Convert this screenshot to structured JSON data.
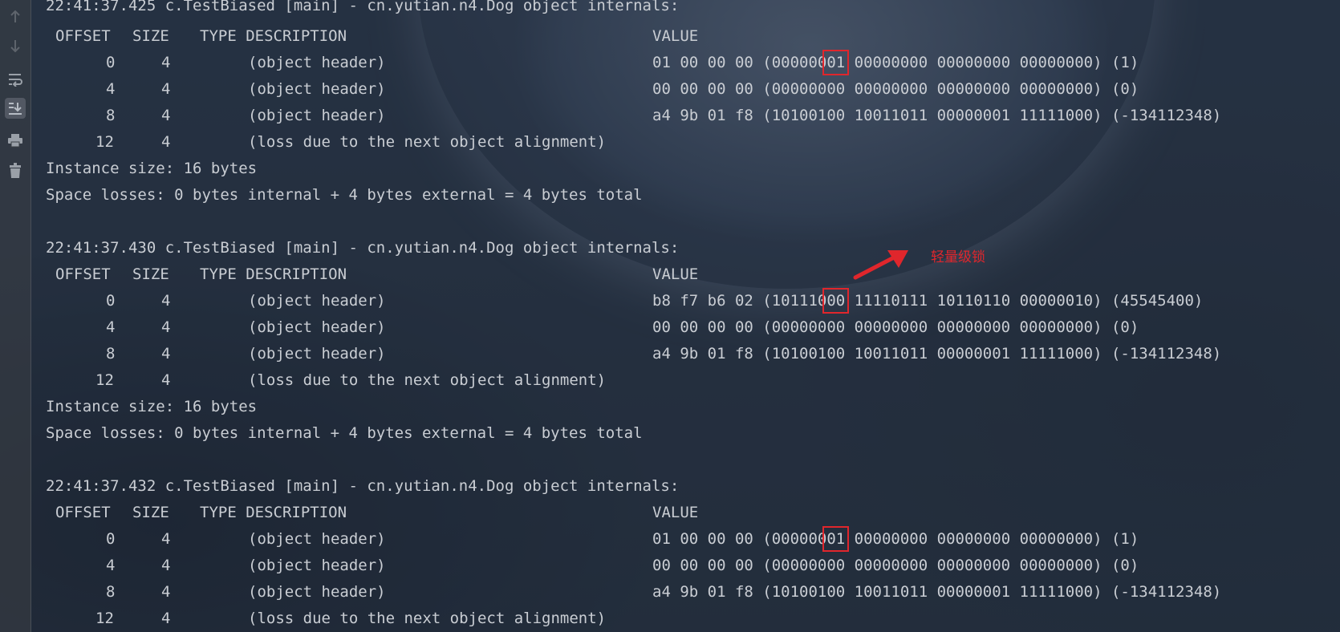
{
  "toolbar": {
    "items": [
      {
        "name": "up-arrow-icon",
        "glyph": "↑"
      },
      {
        "name": "down-arrow-icon",
        "glyph": "↓"
      },
      {
        "name": "soft-wrap-icon",
        "glyph": "⤶"
      },
      {
        "name": "scroll-to-end-icon",
        "glyph": "⤓"
      },
      {
        "name": "print-icon",
        "glyph": "🖶"
      },
      {
        "name": "trash-icon",
        "glyph": "🗑"
      }
    ]
  },
  "annotation": {
    "label": "轻量级锁",
    "color": "#e0262c"
  },
  "blocks": [
    {
      "title": "22:41:37.425 c.TestBiased [main] - cn.yutian.n4.Dog object internals:",
      "header": {
        "offset": "OFFSET",
        "size": "SIZE",
        "type_desc": "TYPE DESCRIPTION",
        "value": "VALUE"
      },
      "rows": [
        {
          "offset": "0",
          "size": "4",
          "desc": "(object header)",
          "value_pre": "01 00 00 00 (000000",
          "value_hl": "01",
          "value_post": " 00000000 00000000 00000000) (1)"
        },
        {
          "offset": "4",
          "size": "4",
          "desc": "(object header)",
          "value_pre": "00 00 00 00 (00000000 00000000 00000000 00000000) (0)",
          "value_hl": "",
          "value_post": ""
        },
        {
          "offset": "8",
          "size": "4",
          "desc": "(object header)",
          "value_pre": "a4 9b 01 f8 (10100100 10011011 00000001 11111000) (-134112348)",
          "value_hl": "",
          "value_post": ""
        },
        {
          "offset": "12",
          "size": "4",
          "desc": "(loss due to the next object alignment)",
          "value_pre": "",
          "value_hl": "",
          "value_post": ""
        }
      ],
      "instance_size": "Instance size: 16 bytes",
      "space_losses": "Space losses: 0 bytes internal + 4 bytes external = 4 bytes total"
    },
    {
      "title": "22:41:37.430 c.TestBiased [main] - cn.yutian.n4.Dog object internals:",
      "header": {
        "offset": "OFFSET",
        "size": "SIZE",
        "type_desc": "TYPE DESCRIPTION",
        "value": "VALUE"
      },
      "rows": [
        {
          "offset": "0",
          "size": "4",
          "desc": "(object header)",
          "value_pre": "b8 f7 b6 02 (101110",
          "value_hl": "00",
          "value_post": " 11110111 10110110 00000010) (45545400)"
        },
        {
          "offset": "4",
          "size": "4",
          "desc": "(object header)",
          "value_pre": "00 00 00 00 (00000000 00000000 00000000 00000000) (0)",
          "value_hl": "",
          "value_post": ""
        },
        {
          "offset": "8",
          "size": "4",
          "desc": "(object header)",
          "value_pre": "a4 9b 01 f8 (10100100 10011011 00000001 11111000) (-134112348)",
          "value_hl": "",
          "value_post": ""
        },
        {
          "offset": "12",
          "size": "4",
          "desc": "(loss due to the next object alignment)",
          "value_pre": "",
          "value_hl": "",
          "value_post": ""
        }
      ],
      "instance_size": "Instance size: 16 bytes",
      "space_losses": "Space losses: 0 bytes internal + 4 bytes external = 4 bytes total"
    },
    {
      "title": "22:41:37.432 c.TestBiased [main] - cn.yutian.n4.Dog object internals:",
      "header": {
        "offset": "OFFSET",
        "size": "SIZE",
        "type_desc": "TYPE DESCRIPTION",
        "value": "VALUE"
      },
      "rows": [
        {
          "offset": "0",
          "size": "4",
          "desc": "(object header)",
          "value_pre": "01 00 00 00 (000000",
          "value_hl": "01",
          "value_post": " 00000000 00000000 00000000) (1)"
        },
        {
          "offset": "4",
          "size": "4",
          "desc": "(object header)",
          "value_pre": "00 00 00 00 (00000000 00000000 00000000 00000000) (0)",
          "value_hl": "",
          "value_post": ""
        },
        {
          "offset": "8",
          "size": "4",
          "desc": "(object header)",
          "value_pre": "a4 9b 01 f8 (10100100 10011011 00000001 11111000) (-134112348)",
          "value_hl": "",
          "value_post": ""
        },
        {
          "offset": "12",
          "size": "4",
          "desc": "(loss due to the next object alignment)",
          "value_pre": "",
          "value_hl": "",
          "value_post": ""
        }
      ]
    }
  ]
}
